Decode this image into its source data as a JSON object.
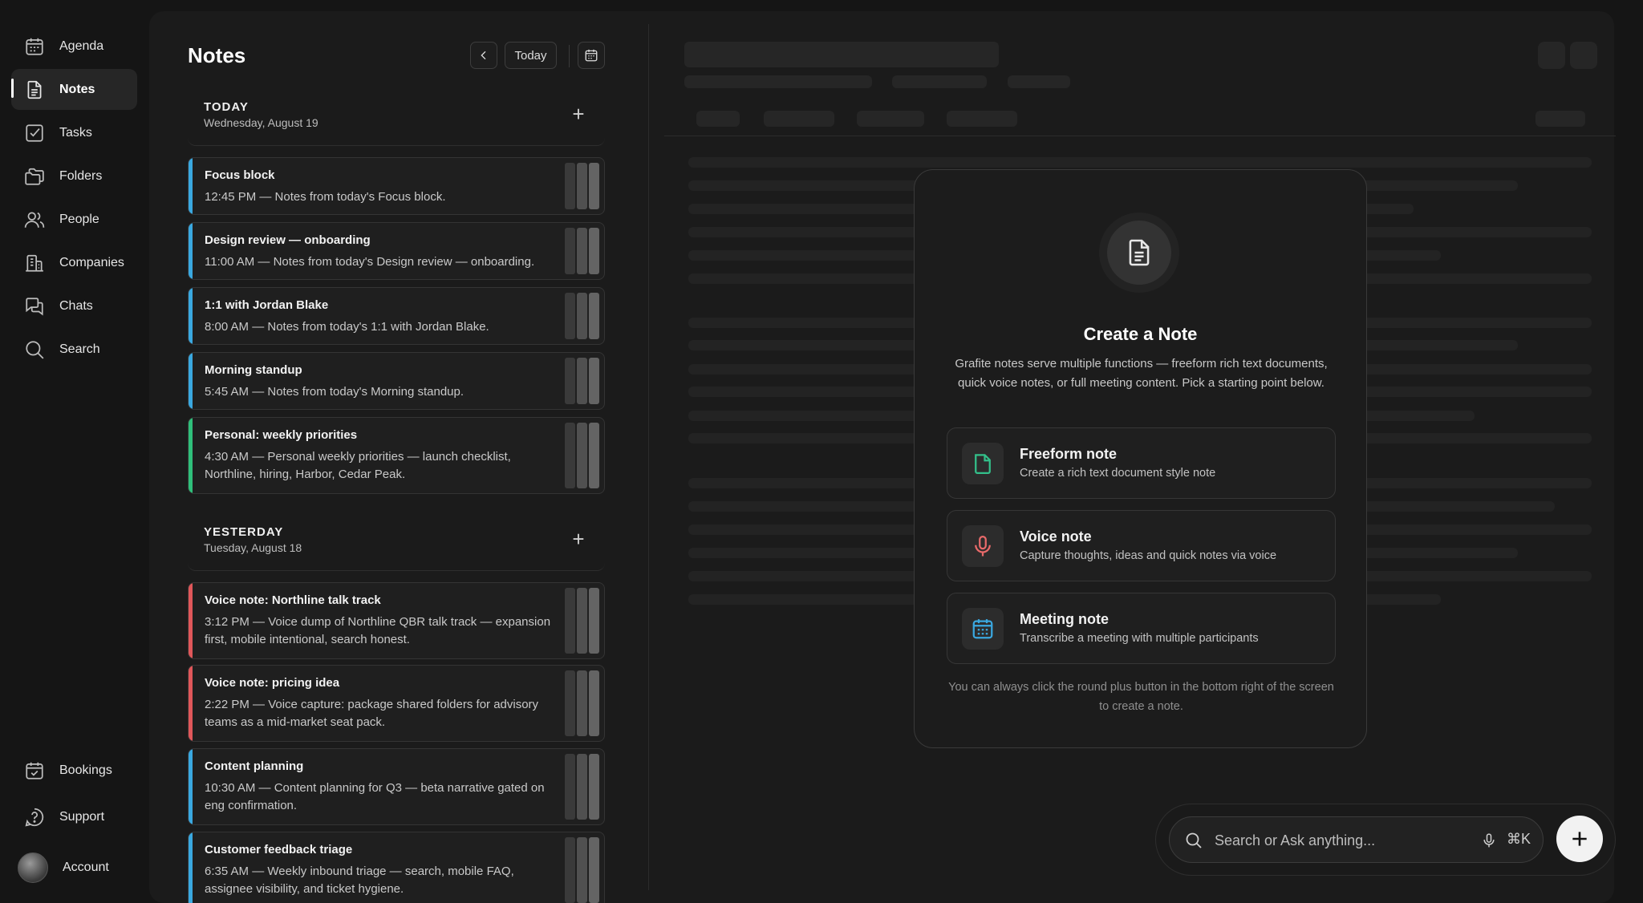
{
  "sidebar": {
    "items": [
      {
        "label": "Agenda",
        "icon": "calendar-icon"
      },
      {
        "label": "Notes",
        "icon": "document-icon"
      },
      {
        "label": "Tasks",
        "icon": "checkbox-icon"
      },
      {
        "label": "Folders",
        "icon": "folders-icon"
      },
      {
        "label": "People",
        "icon": "people-icon"
      },
      {
        "label": "Companies",
        "icon": "building-icon"
      },
      {
        "label": "Chats",
        "icon": "chat-bubbles-icon"
      },
      {
        "label": "Search",
        "icon": "search-icon"
      }
    ],
    "bottom": {
      "bookings": "Bookings",
      "support": "Support",
      "account": "Account"
    },
    "active": "Notes"
  },
  "notes": {
    "title": "Notes",
    "today_button": "Today",
    "sections": [
      {
        "title": "TODAY",
        "date": "Wednesday, August 19",
        "items": [
          {
            "title": "Focus block",
            "desc": "12:45 PM — Notes from today's Focus block.",
            "accent": "#3aa8e0"
          },
          {
            "title": "Design review — onboarding",
            "desc": "11:00 AM — Notes from today's Design review — onboarding.",
            "accent": "#3aa8e0"
          },
          {
            "title": "1:1 with Jordan Blake",
            "desc": "8:00 AM — Notes from today's 1:1 with Jordan Blake.",
            "accent": "#3aa8e0"
          },
          {
            "title": "Morning standup",
            "desc": "5:45 AM — Notes from today's Morning standup.",
            "accent": "#3aa8e0"
          },
          {
            "title": "Personal: weekly priorities",
            "desc": "4:30 AM — Personal weekly priorities — launch checklist, Northline, hiring, Harbor, Cedar Peak.",
            "accent": "#2fbf7a"
          }
        ]
      },
      {
        "title": "YESTERDAY",
        "date": "Tuesday, August 18",
        "items": [
          {
            "title": "Voice note: Northline talk track",
            "desc": "3:12 PM — Voice dump of Northline QBR talk track — expansion first, mobile intentional, search honest.",
            "accent": "#e0575a"
          },
          {
            "title": "Voice note: pricing idea",
            "desc": "2:22 PM — Voice capture: package shared folders for advisory teams as a mid-market seat pack.",
            "accent": "#e0575a"
          },
          {
            "title": "Content planning",
            "desc": "10:30 AM — Content planning for Q3 — beta narrative gated on eng confirmation.",
            "accent": "#3aa8e0"
          },
          {
            "title": "Customer feedback triage",
            "desc": "6:35 AM — Weekly inbound triage — search, mobile FAQ, assignee visibility, and ticket hygiene.",
            "accent": "#3aa8e0"
          }
        ]
      }
    ]
  },
  "modal": {
    "title": "Create a Note",
    "description": "Grafite notes serve multiple functions — freeform rich text documents, quick voice notes, or full meeting content. Pick a starting point below.",
    "options": [
      {
        "title": "Freeform note",
        "desc": "Create a rich text document style note",
        "icon": "file-icon",
        "color": "#33c08a"
      },
      {
        "title": "Voice note",
        "desc": "Capture thoughts, ideas and quick notes via voice",
        "icon": "microphone-icon",
        "color": "#e86a6a"
      },
      {
        "title": "Meeting note",
        "desc": "Transcribe a meeting with multiple participants",
        "icon": "calendar-icon",
        "color": "#3aa8e0"
      }
    ],
    "footer": "You can always click the round plus button in the bottom right of the screen to create a note."
  },
  "search": {
    "placeholder": "Search or Ask anything...",
    "shortcut": "⌘K"
  }
}
